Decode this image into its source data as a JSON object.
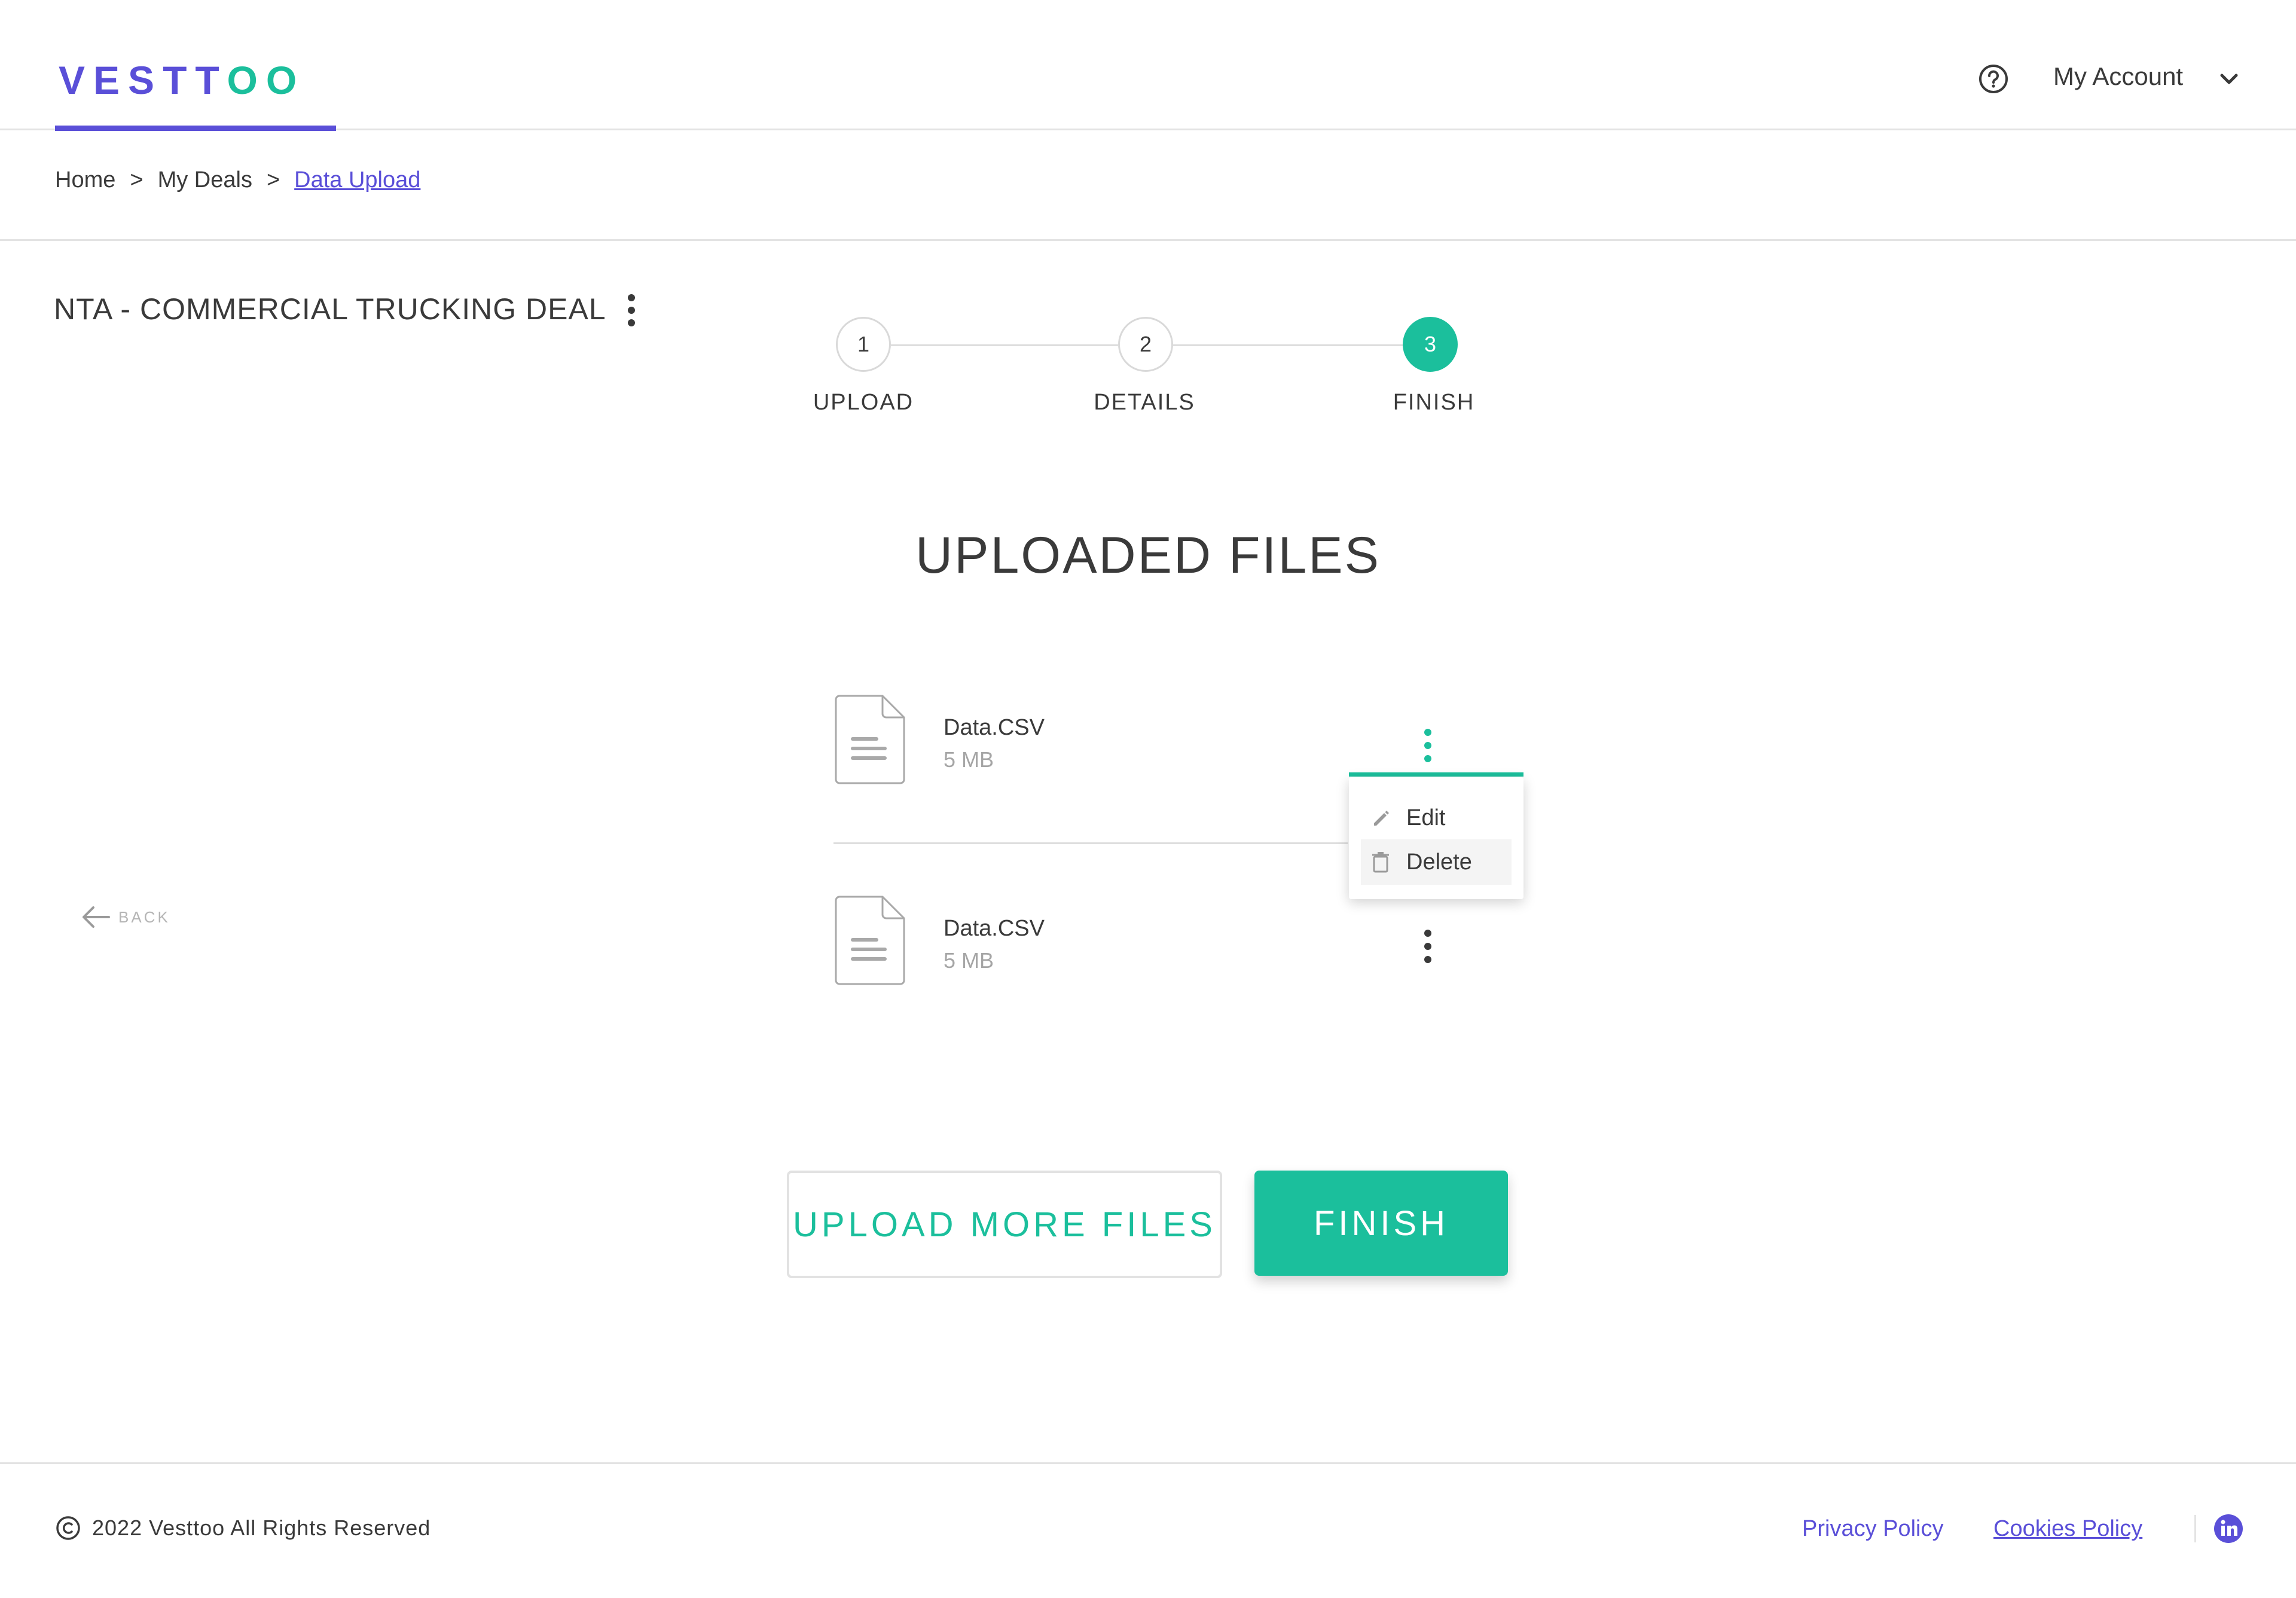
{
  "header": {
    "logo_part1": "VESTT",
    "logo_part2": "OO",
    "help_icon": "question-circle-icon",
    "account_label": "My Account",
    "account_icon": "chevron-down-icon"
  },
  "breadcrumb": {
    "items": [
      "Home",
      "My Deals",
      "Data Upload"
    ],
    "separator": ">"
  },
  "deal": {
    "title": "NTA - COMMERCIAL TRUCKING DEAL"
  },
  "stepper": {
    "steps": [
      {
        "number": "1",
        "label": "UPLOAD",
        "active": false
      },
      {
        "number": "2",
        "label": "DETAILS",
        "active": false
      },
      {
        "number": "3",
        "label": "FINISH",
        "active": true
      }
    ]
  },
  "main": {
    "title": "UPLOADED FILES",
    "files": [
      {
        "name": "Data.CSV",
        "size": "5 MB"
      },
      {
        "name": "Data.CSV",
        "size": "5 MB"
      }
    ],
    "context_menu": {
      "items": [
        "Edit",
        "Delete"
      ]
    },
    "back_label": "BACK"
  },
  "actions": {
    "upload_more_label": "UPLOAD MORE FILES",
    "finish_label": "FINISH"
  },
  "footer": {
    "copyright": "2022 Vesttoo All Rights Reserved",
    "privacy": "Privacy Policy",
    "cookies": "Cookies Policy",
    "social_icon": "linkedin-icon"
  },
  "colors": {
    "brand_purple": "#5a4fd8",
    "brand_teal": "#1bbf9c",
    "text": "#3a3a3a",
    "muted": "#a5a5a5"
  }
}
